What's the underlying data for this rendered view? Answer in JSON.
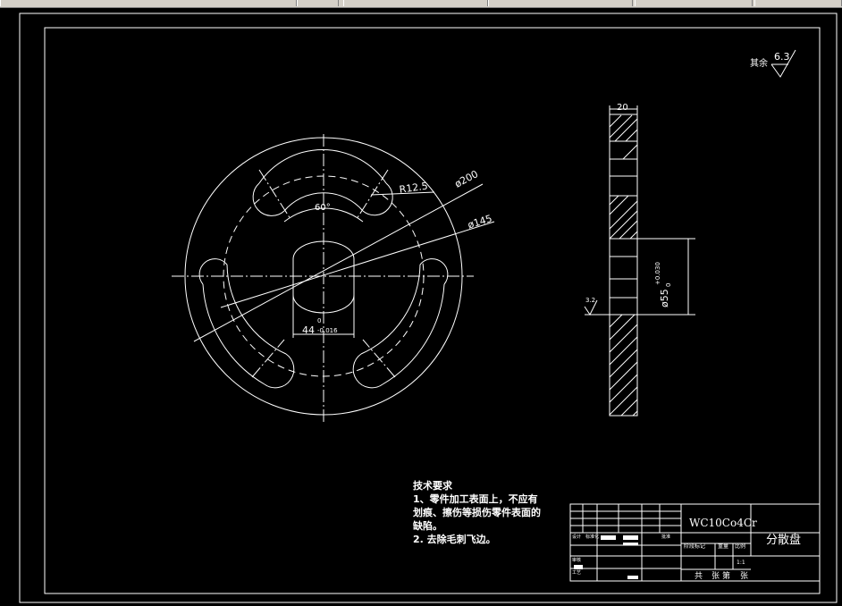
{
  "toolbar": {
    "visible": true
  },
  "drawing": {
    "roughness": {
      "label": "其余",
      "value": "6.3"
    },
    "front_view": {
      "dim_outer": "ø200",
      "dim_bolt_circle": "ø145",
      "dim_slot_radius": "R12.5",
      "dim_angle": "60°",
      "dim_width_base": "44",
      "dim_width_upper_tol": "0",
      "dim_width_lower_tol": "-0.016"
    },
    "side_view": {
      "dim_thickness": "20",
      "dim_bore_base": "ø55",
      "dim_bore_upper_tol": "+0.030",
      "dim_bore_lower_tol": "0",
      "roughness_value": "3.2"
    },
    "tech_requirements": {
      "title": "技术要求",
      "line1": "1、零件加工表面上，不应有",
      "line2": "划痕、擦伤等损伤零件表面的",
      "line3": "缺陷。",
      "line4": "2. 去除毛刺飞边。"
    },
    "title_block": {
      "material": "WC10Co4Cr",
      "part_name": "分散盘",
      "stage_label": "阶段标记",
      "weight_label": "重量",
      "scale_label": "比例",
      "scale_value": "1:1",
      "sheet_total": "共",
      "sheet_unit": "张",
      "sheet_num": "第",
      "sheet_unit2": "张",
      "design_label": "设计",
      "std_label": "标准化",
      "check_label": "审核",
      "process_label": "工艺",
      "approve_label": "批准"
    }
  },
  "colors": {
    "background": "#000000",
    "line": "#ffffff",
    "toolbar": "#d4d0c8"
  }
}
